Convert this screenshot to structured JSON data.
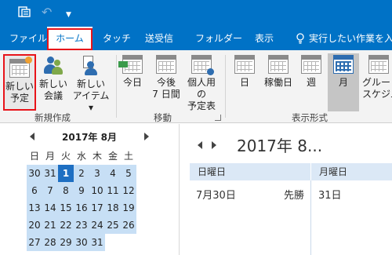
{
  "titlebar": {
    "icons": [
      "app-icon",
      "undo-icon",
      "customize-quick-access-icon"
    ],
    "undo_glyph": "↶",
    "more_glyph": "▼"
  },
  "tabs": [
    {
      "label": "ファイル"
    },
    {
      "label": "ホーム",
      "active": true
    },
    {
      "label": "タッチ"
    },
    {
      "label": "送受信"
    },
    {
      "label": "フォルダー"
    },
    {
      "label": "表示"
    },
    {
      "label": "実行したい作業を入力"
    }
  ],
  "ribbon": {
    "new_group": {
      "label": "新規作成",
      "buttons": [
        {
          "label": "新しい\n予定",
          "icon": "new-appointment-icon",
          "highlighted": true
        },
        {
          "label": "新しい\n会議",
          "icon": "new-meeting-icon"
        },
        {
          "label": "新しい\nアイテム▾",
          "icon": "new-items-icon"
        }
      ]
    },
    "goto_group": {
      "label": "移動",
      "buttons": [
        {
          "label": "今日",
          "icon": "today-icon"
        },
        {
          "label": "今後\n7 日間",
          "icon": "next-7-days-icon"
        },
        {
          "label": "個人用の\n予定表",
          "icon": "personal-calendar-icon"
        }
      ]
    },
    "arrange_group": {
      "label": "表示形式",
      "buttons": [
        {
          "label": "日",
          "icon": "day-view-icon"
        },
        {
          "label": "稼働日",
          "icon": "work-week-view-icon"
        },
        {
          "label": "週",
          "icon": "week-view-icon"
        },
        {
          "label": "月",
          "icon": "month-view-icon",
          "selected": true
        },
        {
          "label": "グルー\nスケジュ",
          "icon": "schedule-view-icon"
        }
      ]
    },
    "colors": {
      "highlight_border": "#e8141a",
      "ribbon_bg": "#f3f3f3",
      "brand": "#0072c6"
    }
  },
  "date_navigator": {
    "title": "2017年 8月",
    "weekdays": [
      "日",
      "月",
      "火",
      "水",
      "木",
      "金",
      "土"
    ],
    "weeks": [
      [
        "30",
        "31",
        "1",
        "2",
        "3",
        "4",
        "5"
      ],
      [
        "6",
        "7",
        "8",
        "9",
        "10",
        "11",
        "12"
      ],
      [
        "13",
        "14",
        "15",
        "16",
        "17",
        "18",
        "19"
      ],
      [
        "20",
        "21",
        "22",
        "23",
        "24",
        "25",
        "26"
      ],
      [
        "27",
        "28",
        "29",
        "30",
        "31",
        "",
        ""
      ]
    ],
    "today": "1",
    "colors": {
      "shaded": "#c7dff5",
      "today": "#1e6fc2"
    }
  },
  "calendar": {
    "title": "2017年 8...",
    "columns": [
      "日曜日",
      "月曜日"
    ],
    "cells": [
      {
        "date": "7月30日",
        "note": "先勝"
      },
      {
        "date": "31日",
        "note": ""
      }
    ]
  }
}
